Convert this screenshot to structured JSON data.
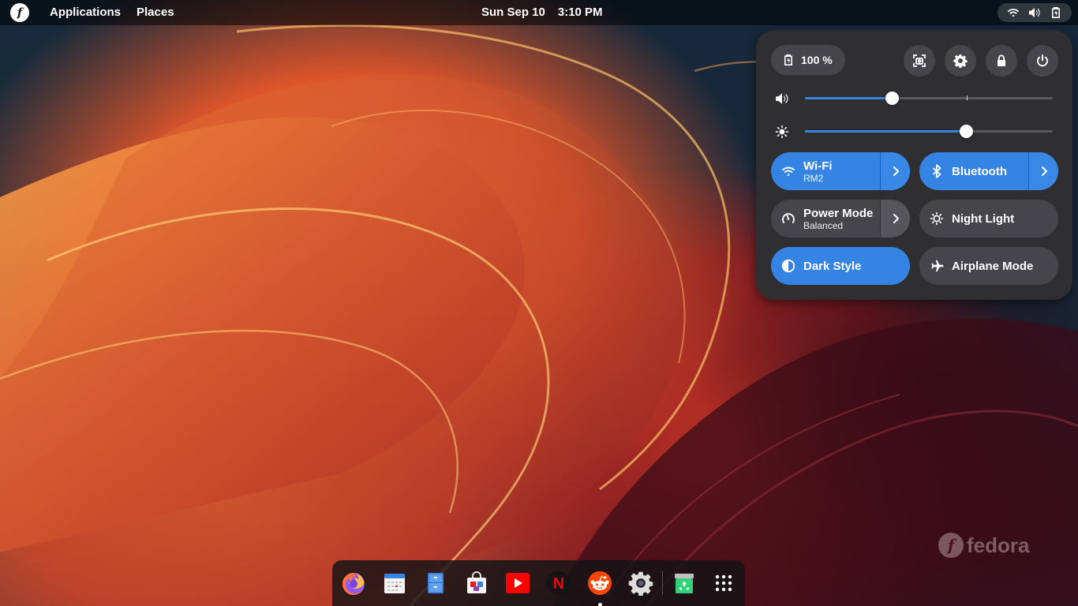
{
  "topbar": {
    "logo_glyph": "f",
    "menus": [
      "Applications",
      "Places"
    ],
    "date": "Sun Sep 10",
    "time": "3:10 PM",
    "tray_icons": [
      "wifi-icon",
      "volume-icon",
      "battery-icon"
    ]
  },
  "quick_settings": {
    "battery_label": "100 %",
    "buttons": [
      "screenshot-icon",
      "settings-icon",
      "lock-icon",
      "power-icon"
    ],
    "volume_level": 0.35,
    "brightness_level": 0.65,
    "toggles": [
      {
        "title": "Wi-Fi",
        "subtitle": "RM2",
        "active": true,
        "has_arrow": true,
        "icon": "wifi-icon"
      },
      {
        "title": "Bluetooth",
        "subtitle": "",
        "active": true,
        "has_arrow": true,
        "icon": "bluetooth-icon"
      },
      {
        "title": "Power Mode",
        "subtitle": "Balanced",
        "active": false,
        "has_arrow": true,
        "icon": "power-mode-icon"
      },
      {
        "title": "Night Light",
        "subtitle": "",
        "active": false,
        "has_arrow": false,
        "icon": "night-light-icon"
      },
      {
        "title": "Dark Style",
        "subtitle": "",
        "active": true,
        "has_arrow": false,
        "icon": "dark-style-icon"
      },
      {
        "title": "Airplane Mode",
        "subtitle": "",
        "active": false,
        "has_arrow": false,
        "icon": "airplane-icon"
      }
    ]
  },
  "watermark": {
    "logo_glyph": "f",
    "text": "fedora"
  },
  "dock": {
    "apps": [
      "firefox-icon",
      "calendar-icon",
      "files-icon",
      "software-icon",
      "youtube-icon",
      "netflix-icon",
      "reddit-icon",
      "settings-icon",
      "trash-icon",
      "app-grid-icon"
    ],
    "running": "reddit-icon",
    "netflix_letter": "N"
  },
  "colors": {
    "accent": "#3584e4",
    "panel": "#2f2f31",
    "button": "#46464a"
  }
}
